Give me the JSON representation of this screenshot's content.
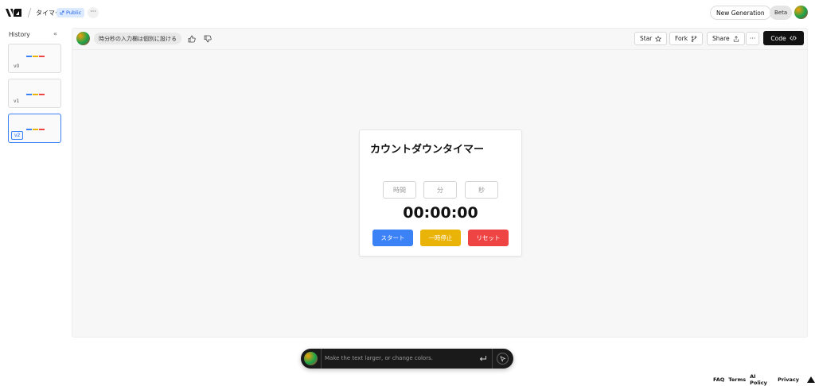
{
  "header": {
    "project_name": "タイマー",
    "visibility_badge": "Public",
    "more_label": "···",
    "new_generation_label": "New Generation",
    "beta_label": "Beta"
  },
  "sidebar": {
    "title": "History",
    "versions": [
      "v0",
      "v1",
      "v2"
    ],
    "active_version": "v2"
  },
  "toolbar": {
    "prompt_text": "時分秒の入力欄は個別に設ける",
    "star_label": "Star",
    "fork_label": "Fork",
    "share_label": "Share",
    "more_label": "···",
    "code_label": "Code"
  },
  "preview": {
    "card_title": "カウントダウンタイマー",
    "hours_placeholder": "時間",
    "minutes_placeholder": "分",
    "seconds_placeholder": "秒",
    "timer_display": "00:00:00",
    "start_label": "スタート",
    "pause_label": "一時停止",
    "reset_label": "リセット"
  },
  "chat": {
    "placeholder": "Make the text larger, or change colors."
  },
  "footer": {
    "links": [
      "FAQ",
      "Terms",
      "AI Policy",
      "Privacy"
    ]
  },
  "colors": {
    "start_button": "#3b82f6",
    "pause_button": "#eab308",
    "reset_button": "#ef4444",
    "code_button": "#111111",
    "accent_blue": "#2563eb"
  },
  "icons": {
    "logo": "v0-logo",
    "star": "star-icon",
    "fork": "fork-icon",
    "share": "share-icon",
    "code": "code-icon",
    "thumbs_up": "thumbs-up-icon",
    "thumbs_down": "thumbs-down-icon",
    "enter": "enter-icon",
    "pointer": "pointer-select-icon"
  }
}
